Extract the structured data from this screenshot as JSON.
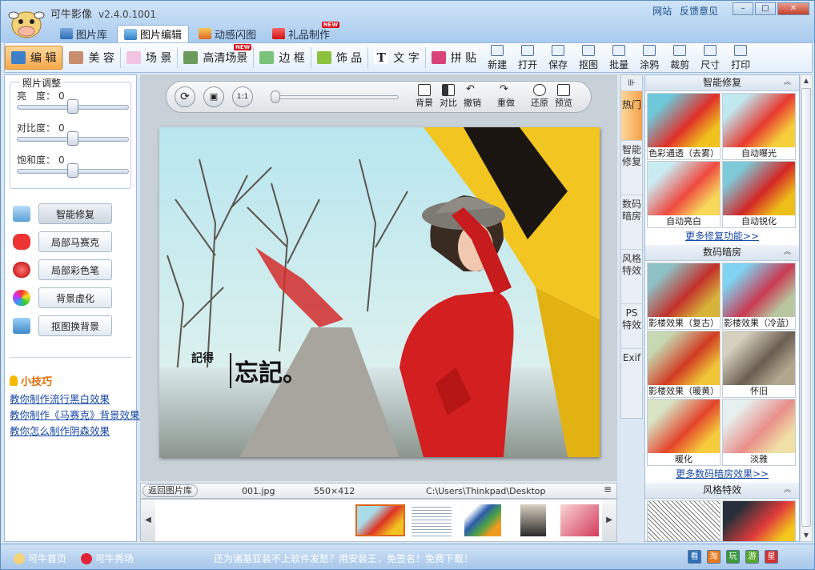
{
  "app": {
    "name": "可牛影像",
    "version": "v2.4.0.1001",
    "links": [
      "网站",
      "反馈意见"
    ]
  },
  "window_buttons": [
    "–",
    "□",
    "✕"
  ],
  "main_tabs": [
    {
      "label": "图片库",
      "icon": "photo-library-icon"
    },
    {
      "label": "图片编辑",
      "icon": "edit-icon",
      "active": true
    },
    {
      "label": "动感闪图",
      "icon": "flash-icon"
    },
    {
      "label": "礼品制作",
      "icon": "gift-icon",
      "badge": "NEW"
    }
  ],
  "toolbar": {
    "tools": [
      {
        "label": "编 辑",
        "icon": "edit-tool-icon",
        "active": true
      },
      {
        "label": "美 容",
        "icon": "beauty-icon"
      },
      {
        "label": "场 景",
        "icon": "scene-icon"
      },
      {
        "label": "高清场景",
        "icon": "hd-scene-icon",
        "badge": "NEW"
      },
      {
        "label": "边 框",
        "icon": "frame-icon"
      },
      {
        "label": "饰 品",
        "icon": "accessory-icon"
      },
      {
        "label": "文 字",
        "icon": "text-icon"
      },
      {
        "label": "拼 贴",
        "icon": "collage-icon"
      }
    ],
    "actions": [
      {
        "label": "新建",
        "icon": "new-icon"
      },
      {
        "label": "打开",
        "icon": "open-icon"
      },
      {
        "label": "保存",
        "icon": "save-icon"
      },
      {
        "label": "抠图",
        "icon": "cutout-icon"
      },
      {
        "label": "批量",
        "icon": "batch-icon"
      },
      {
        "label": "涂鸦",
        "icon": "doodle-icon"
      },
      {
        "label": "裁剪",
        "icon": "crop-icon"
      },
      {
        "label": "尺寸",
        "icon": "resize-icon"
      },
      {
        "label": "打印",
        "icon": "print-icon"
      }
    ]
  },
  "adjust": {
    "title": "照片调整",
    "brightness": {
      "label": "亮　度：",
      "value": "0",
      "level": 0.5
    },
    "contrast": {
      "label": "对比度：",
      "value": "0",
      "level": 0.5
    },
    "saturation": {
      "label": "饱和度：",
      "value": "0",
      "level": 0.5
    }
  },
  "functions": [
    {
      "label": "智能修复",
      "icon": "magic-wand-icon",
      "selected": true
    },
    {
      "label": "局部马赛克",
      "icon": "mosaic-icon"
    },
    {
      "label": "局部彩色笔",
      "icon": "color-pen-icon"
    },
    {
      "label": "背景虚化",
      "icon": "blur-icon"
    },
    {
      "label": "抠图换背景",
      "icon": "replace-bg-icon"
    }
  ],
  "tips": {
    "title": "小技巧",
    "links": [
      "教你制作流行黑白效果",
      "教你制作《马赛克》背景效果",
      "教你怎么制作阴森效果"
    ]
  },
  "canvas_controls": {
    "zoom_label": "1:1",
    "buttons": [
      {
        "label": "背景",
        "icon": "background-icon"
      },
      {
        "label": "对比",
        "icon": "compare-icon"
      },
      {
        "label": "撤销",
        "icon": "undo-icon"
      },
      {
        "label": "重做",
        "icon": "redo-icon"
      },
      {
        "label": "还原",
        "icon": "restore-icon"
      },
      {
        "label": "预览",
        "icon": "preview-icon"
      }
    ]
  },
  "photo": {
    "caption_small": "記得",
    "caption_big": "忘記。"
  },
  "filebar": {
    "back_label": "返回图片库",
    "filename": "001.jpg",
    "dimensions": "550×412",
    "path": "C:\\Users\\Thinkpad\\Desktop"
  },
  "side_tabs": [
    "热门",
    "智能修复",
    "数码暗房",
    "风格特效",
    "PS特效",
    "Exif"
  ],
  "effects": {
    "smart_repair": {
      "title": "智能修复",
      "items": [
        "色彩通透（去雾）",
        "自动曝光",
        "自动亮白",
        "自动锐化"
      ],
      "more": "更多修复功能>>"
    },
    "darkroom": {
      "title": "数码暗房",
      "items": [
        "影楼效果（复古）",
        "影楼效果（冷蓝）",
        "影楼效果（暖黄）",
        "怀旧",
        "暖化",
        "淡雅"
      ],
      "more": "更多数码暗房效果>>"
    },
    "style": {
      "title": "风格特效"
    }
  },
  "status": {
    "home": "可牛首页",
    "show": "可牛秀场",
    "message": "还为诸基亚装不上软件发愁？用安装王，免签名！免费下载！",
    "buttons": [
      "看",
      "淘",
      "玩",
      "游",
      "星"
    ]
  }
}
